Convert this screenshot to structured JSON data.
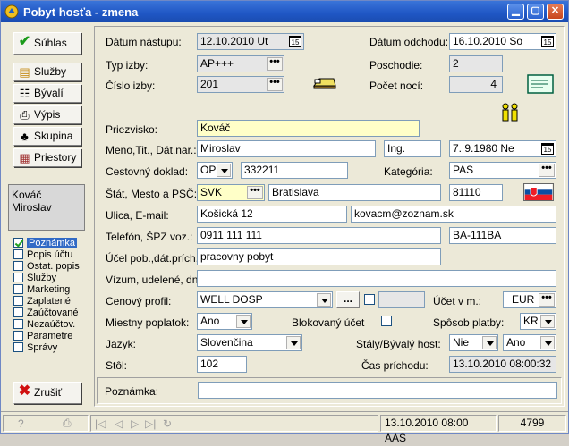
{
  "window": {
    "title": "Pobyt hosťa - zmena"
  },
  "nav": {
    "suhlas": "Súhlas",
    "sluzby": "Služby",
    "byvali": "Bývalí",
    "vypis": "Výpis",
    "skupina": "Skupina",
    "priestory": "Priestory",
    "zrusit": "Zrušiť"
  },
  "guest_name": "Kováč Miroslav",
  "checks": [
    {
      "label": "Poznámka",
      "checked": true
    },
    {
      "label": "Popis účtu",
      "checked": false
    },
    {
      "label": "Ostat. popis",
      "checked": false
    },
    {
      "label": "Služby",
      "checked": false
    },
    {
      "label": "Marketing",
      "checked": false
    },
    {
      "label": "Zaplatené",
      "checked": false
    },
    {
      "label": "Zaúčtované",
      "checked": false
    },
    {
      "label": "Nezaúčtov.",
      "checked": false
    },
    {
      "label": "Parametre",
      "checked": false
    },
    {
      "label": "Správy",
      "checked": false
    }
  ],
  "form": {
    "datum_nastupu_label": "Dátum nástupu:",
    "datum_nastupu": "12.10.2010 Ut",
    "datum_odchodu_label": "Dátum odchodu:",
    "datum_odchodu": "16.10.2010 So",
    "typ_izby_label": "Typ izby:",
    "typ_izby": "AP+++",
    "poschodie_label": "Poschodie:",
    "poschodie": "2",
    "cislo_izby_label": "Číslo izby:",
    "cislo_izby": "201",
    "pocet_noci_label": "Počet nocí:",
    "pocet_noci": "4",
    "priezvisko_label": "Priezvisko:",
    "priezvisko": "Kováč",
    "meno_label": "Meno,Tit., Dát.nar.:",
    "meno": "Miroslav",
    "titul": "Ing.",
    "datum_narodenia": "7. 9.1980   Ne",
    "doklad_label": "Cestovný doklad:",
    "doklad_typ": "OP",
    "doklad_cislo": "332211",
    "kategoria_label": "Kategória:",
    "kategoria": "PAS",
    "stat_label": "Štát, Mesto a PSČ:",
    "stat": "SVK",
    "mesto": "Bratislava",
    "psc": "81110",
    "ulica_label": "Ulica, E-mail:",
    "ulica": "Košická 12",
    "email": "kovacm@zoznam.sk",
    "telefon_label": "Telefón, ŠPZ voz.:",
    "telefon": "0911 111 111",
    "spz": "BA-111BA",
    "ucel_label": "Účel pob.,dát.prích.:",
    "ucel": "pracovny pobyt",
    "vizum_label": "Vízum, udelené, dni:",
    "vizum": "",
    "cenovy_label": "Cenový profil:",
    "cenovy": "WELL DOSP",
    "ellipsis": "...",
    "ucet_label": "Účet v m.:",
    "ucet": "EUR",
    "poplatok_label": "Miestny poplatok:",
    "poplatok": "Ano",
    "blokovany_label": "Blokovaný účet",
    "sposob_label": "Spôsob platby:",
    "sposob": "KR",
    "jazyk_label": "Jazyk:",
    "jazyk": "Slovenčina",
    "staly_label": "Stály/Bývalý host:",
    "staly": "Nie",
    "byvaly": "Ano",
    "stol_label": "Stôl:",
    "stol": "102",
    "cas_label": "Čas príchodu:",
    "cas": "13.10.2010 08:00:32",
    "poznamka_label": "Poznámka:",
    "poznamka": ""
  },
  "status": {
    "datetime_user": "13.10.2010 08:00 AAS",
    "number": "4799"
  }
}
